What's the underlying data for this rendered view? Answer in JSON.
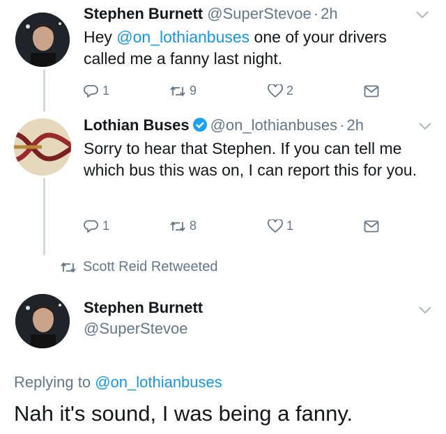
{
  "tweets": [
    {
      "name": "Stephen Burnett",
      "handle": "@SuperStevoe",
      "time": "2h",
      "text_prefix": "Hey ",
      "mention": "@on_lothianbuses",
      "text_suffix": " one of your drivers called me a fanny last night.",
      "replies": "1",
      "retweets": "9",
      "likes": "2"
    },
    {
      "name": "Lothian Buses",
      "handle": "@on_lothianbuses",
      "time": "2h",
      "text": "Sorry to hear that Stephen. If you can tell me which bus this was on, I can report this for you.",
      "replies": "1",
      "retweets": "8",
      "likes": "1"
    }
  ],
  "retweet_notice": "Scott Reid Retweeted",
  "expanded": {
    "name": "Stephen Burnett",
    "handle": "@SuperStevoe",
    "replying_prefix": "Replying to ",
    "replying_to": "@on_lothianbuses",
    "text": "Nah it's sound, I was being a fanny."
  },
  "icons": {
    "reply": "reply-icon",
    "retweet": "retweet-icon",
    "like": "heart-icon",
    "dm": "envelope-icon",
    "menu": "chevron-down-icon",
    "verified": "verified-badge-icon"
  },
  "colors": {
    "link": "#1b95e0",
    "muted": "#657786",
    "verified": "#1da1f2",
    "logo_red": "#9a2a2a"
  }
}
